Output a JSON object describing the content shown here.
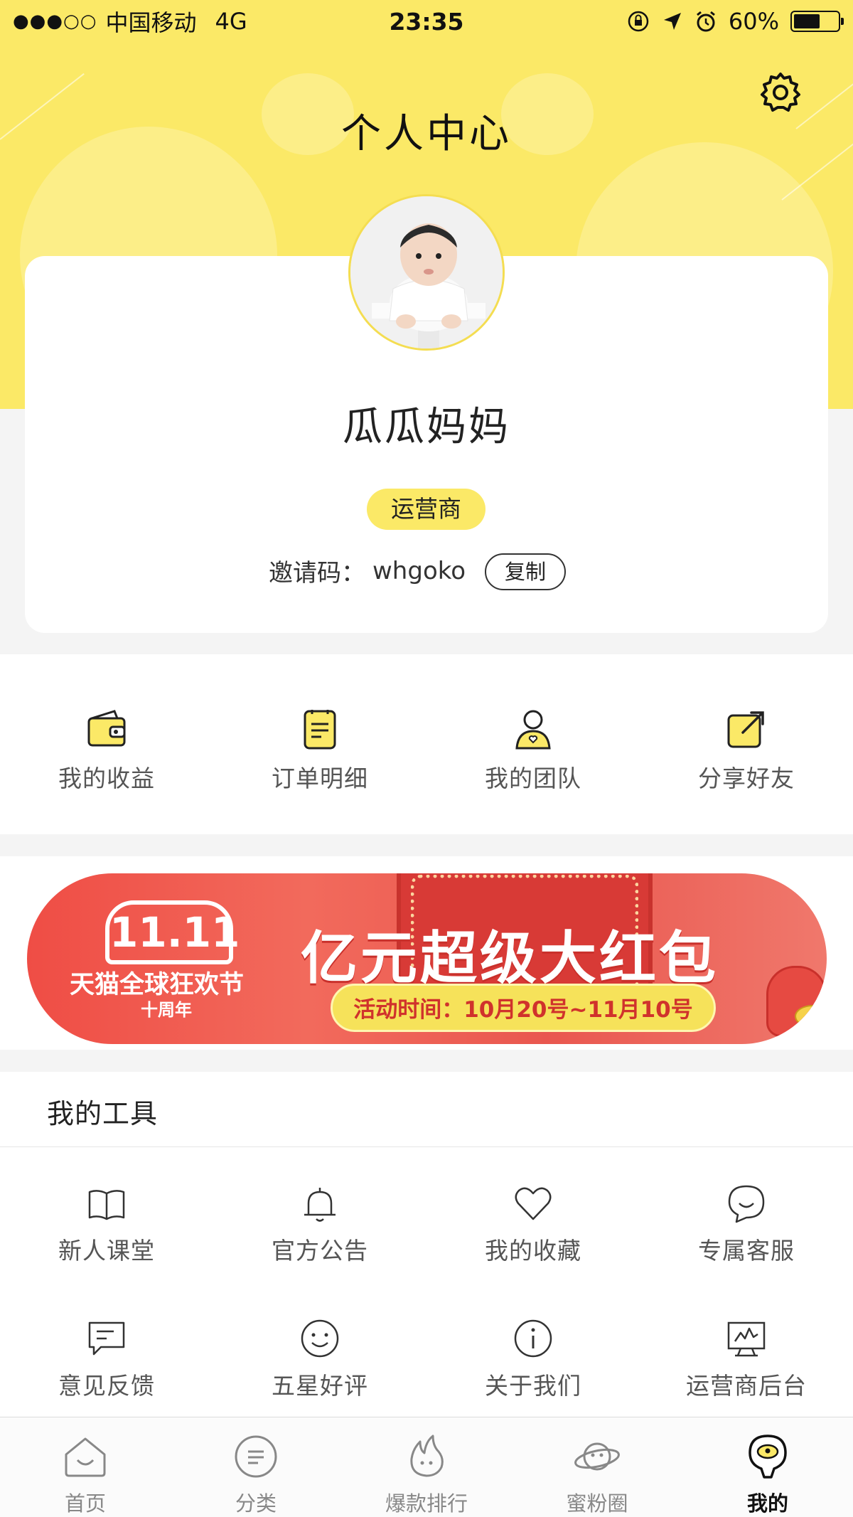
{
  "status_bar": {
    "carrier": "中国移动",
    "network": "4G",
    "time": "23:35",
    "battery": "60%",
    "battery_level": 0.6
  },
  "header": {
    "title": "个人中心",
    "settings_icon": "gear-icon"
  },
  "profile": {
    "nickname": "瓜瓜妈妈",
    "role": "运营商",
    "invite_label": "邀请码：",
    "invite_code": "whgoko",
    "copy_label": "复制"
  },
  "quick_actions": [
    {
      "label": "我的收益",
      "icon": "wallet-icon"
    },
    {
      "label": "订单明细",
      "icon": "order-list-icon"
    },
    {
      "label": "我的团队",
      "icon": "team-icon"
    },
    {
      "label": "分享好友",
      "icon": "share-icon"
    }
  ],
  "banner": {
    "logo_number": "11.11",
    "logo_text": "天猫全球狂欢节",
    "logo_sub": "十周年",
    "title": "亿元超级大红包",
    "period": "活动时间：10月20号~11月10号"
  },
  "tools": {
    "title": "我的工具",
    "items": [
      {
        "label": "新人课堂",
        "icon": "book-icon"
      },
      {
        "label": "官方公告",
        "icon": "bell-icon"
      },
      {
        "label": "我的收藏",
        "icon": "heart-icon"
      },
      {
        "label": "专属客服",
        "icon": "chat-smile-icon"
      },
      {
        "label": "意见反馈",
        "icon": "feedback-icon"
      },
      {
        "label": "五星好评",
        "icon": "smile-icon"
      },
      {
        "label": "关于我们",
        "icon": "info-icon"
      },
      {
        "label": "运营商后台",
        "icon": "dashboard-icon"
      }
    ]
  },
  "tabbar": {
    "items": [
      {
        "label": "首页",
        "icon": "home-icon"
      },
      {
        "label": "分类",
        "icon": "category-icon"
      },
      {
        "label": "爆款排行",
        "icon": "fire-icon"
      },
      {
        "label": "蜜粉圈",
        "icon": "planet-icon"
      },
      {
        "label": "我的",
        "icon": "profile-icon"
      }
    ],
    "active_index": 4
  },
  "colors": {
    "brand_yellow": "#fbe967",
    "banner_red": "#ef4d45",
    "text_dark": "#222222",
    "text_gray": "#555555"
  }
}
